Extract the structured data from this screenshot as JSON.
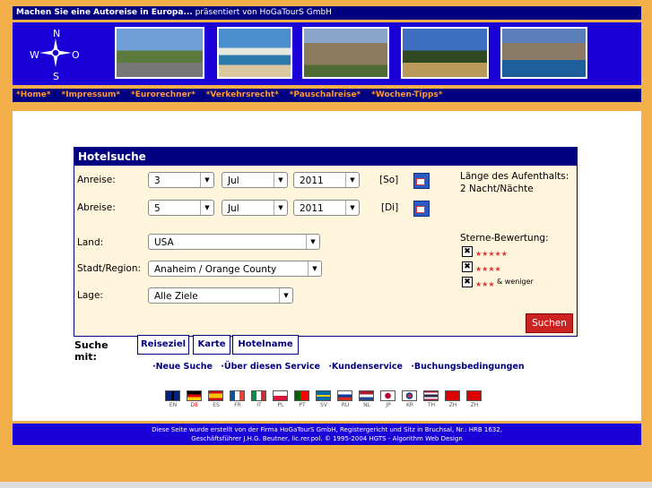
{
  "header": {
    "title": "Machen Sie eine Autoreise in Europa...",
    "subtitle": "präsentiert von HoGaTourS GmbH"
  },
  "compass": {
    "n": "N",
    "w": "W",
    "o": "O",
    "s": "S"
  },
  "nav": {
    "items": [
      "*Home*",
      "*Impressum*",
      "*Eurorechner*",
      "*Verkehrsrecht*",
      "*Pauschalreise*",
      "*Wochen-Tipps*"
    ]
  },
  "form": {
    "title": "Hotelsuche",
    "arrival_label": "Anreise:",
    "arrival_day": "3",
    "arrival_month": "Jul",
    "arrival_year": "2011",
    "arrival_weekday": "[So]",
    "departure_label": "Abreise:",
    "departure_day": "5",
    "departure_month": "Jul",
    "departure_year": "2011",
    "departure_weekday": "[Di]",
    "stay_label": "Länge des Aufenthalts:",
    "stay_value": "2 Nacht/Nächte",
    "country_label": "Land:",
    "country_value": "USA",
    "city_label": "Stadt/Region:",
    "city_value": "Anaheim / Orange County",
    "location_label": "Lage:",
    "location_value": "Alle Ziele",
    "stars_label": "Sterne-Bewertung:",
    "star5": "★★★★★",
    "star4": "★★★★",
    "star3": "★★★",
    "star3_suffix": "& weniger",
    "check_mark": "✖",
    "search_button": "Suchen"
  },
  "search_with": {
    "label": "Suche mit:",
    "tabs": [
      "Reiseziel",
      "Karte",
      "Hotelname"
    ]
  },
  "links": [
    "·Neue Suche",
    "·Über diesen Service",
    "·Kundenservice",
    "·Buchungsbedingungen"
  ],
  "languages": [
    "EN",
    "DE",
    "ES",
    "FR",
    "IT",
    "PL",
    "PT",
    "SV",
    "RU",
    "NL",
    "JP",
    "KR",
    "TH",
    "ZH",
    "ZH"
  ],
  "footer": {
    "line1": "Diese Seite wurde erstellt von der Firma HoGaTourS GmbH, Registergericht und Sitz in Bruchsal, Nr.: HRB 1632,",
    "line2": "Geschäftsführer J.H.G. Beutner, lic.rer.pol. © 1995-2004 HGTS - Algorithm Web Design"
  },
  "colors": {
    "navy": "#000080",
    "banner": "#1a00d6",
    "orange": "#f3b04a",
    "nav_text": "#ff9a33",
    "button": "#cc2222"
  }
}
